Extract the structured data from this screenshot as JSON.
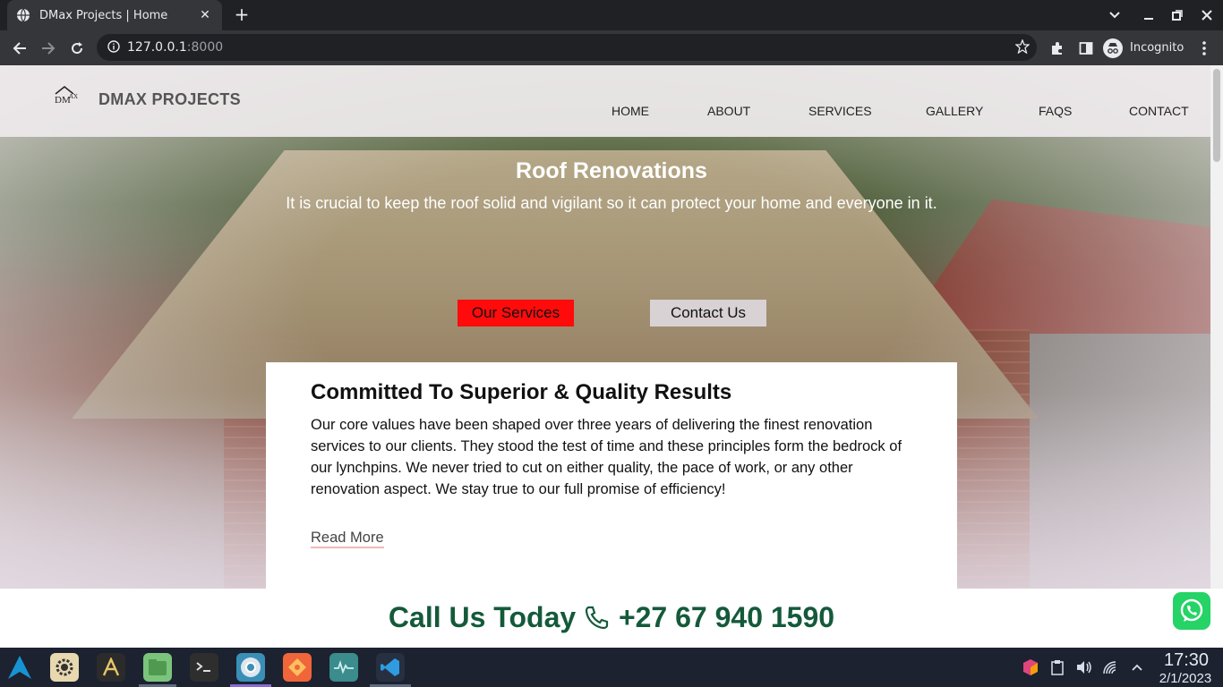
{
  "browser": {
    "tab_title": "DMax Projects | Home",
    "url_host": "127.0.0.1",
    "url_port": ":8000",
    "profile_label": "Incognito"
  },
  "site": {
    "brand": "DMAX PROJECTS",
    "nav": [
      "HOME",
      "ABOUT",
      "SERVICES",
      "GALLERY",
      "FAQS",
      "CONTACT"
    ]
  },
  "hero": {
    "title": "Roof Renovations",
    "subtitle": "It is crucial to keep the roof solid and vigilant so it can protect your home and everyone in it.",
    "primary_button": "Our Services",
    "secondary_button": "Contact Us"
  },
  "card": {
    "title": "Committed To Superior & Quality Results",
    "body": "Our core values have been shaped over three years of delivering the finest renovation services to our clients. They stood the test of time and these principles form the bedrock of our lynchpins. We never tried to cut on either quality, the pace of work, or any other renovation aspect. We stay true to our full promise of efficiency!",
    "link": "Read More"
  },
  "callbar": {
    "label": "Call Us Today",
    "phone": "+27 67 940 1590"
  },
  "taskbar": {
    "apps": [
      "start-menu-icon",
      "settings-app-icon",
      "text-editor-icon",
      "file-manager-icon",
      "terminal-icon",
      "chromium-browser-icon",
      "git-client-icon",
      "system-monitor-icon",
      "vscode-icon"
    ],
    "time": "17:30",
    "date": "2/1/2023"
  },
  "colors": {
    "accent_red": "#ff0b0b",
    "call_green": "#145a3a",
    "whatsapp_green": "#25d366"
  }
}
